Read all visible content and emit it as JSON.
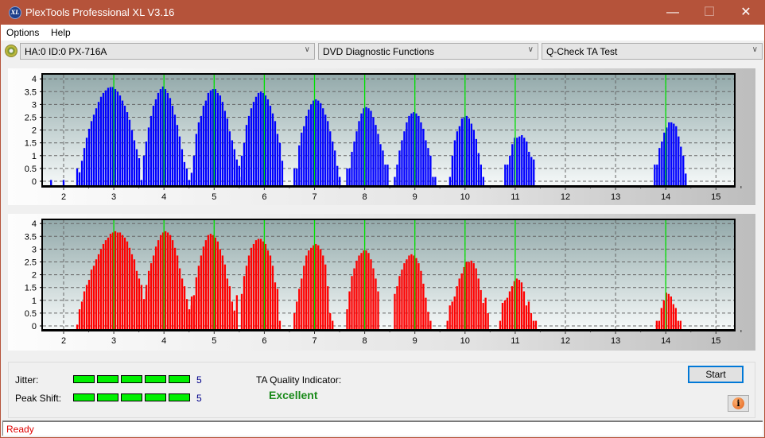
{
  "window": {
    "title": "PlexTools Professional XL V3.16",
    "app_icon_label": "XL",
    "controls": {
      "minimize": "—",
      "maximize": "☐",
      "close": "✕"
    }
  },
  "menu": {
    "items": [
      {
        "label": "Options"
      },
      {
        "label": "Help"
      }
    ]
  },
  "toolbar": {
    "drive_select": "HA:0 ID:0  PX-716A",
    "function_select": "DVD Diagnostic Functions",
    "test_select": "Q-Check TA Test",
    "arrow": "∨"
  },
  "results": {
    "jitter_label": "Jitter:",
    "jitter_score": "5",
    "jitter_fill_fraction": 1.0,
    "peak_shift_label": "Peak Shift:",
    "peak_shift_score": "5",
    "peak_shift_fill_fraction": 1.0,
    "ta_quality_label": "TA Quality Indicator:",
    "ta_quality_value": "Excellent",
    "start_label": "Start",
    "info_glyph": "i"
  },
  "status": {
    "text": "Ready"
  },
  "colors": {
    "top_bars": "#0000ff",
    "bottom_bars": "#ff0000",
    "marker_lines": "#00e000",
    "quality_text": "#1a8a1a",
    "status_text": "#e00000"
  },
  "chart_data": [
    {
      "type": "bar",
      "title": "",
      "name": "top-chart",
      "xlabel": "",
      "ylabel": "",
      "xlim": [
        1.6,
        15.5
      ],
      "ylim": [
        -0.15,
        4.15
      ],
      "xticks": [
        "2",
        "3",
        "4",
        "5",
        "6",
        "7",
        "8",
        "9",
        "10",
        "11",
        "12",
        "13",
        "14",
        "15"
      ],
      "yticks": [
        "0",
        "0.5",
        "1",
        "1.5",
        "2",
        "2.5",
        "3",
        "3.5",
        "4"
      ],
      "grid": true,
      "markers_x": [
        3,
        4,
        5,
        6,
        7,
        8,
        9,
        10,
        11,
        14
      ],
      "clusters": [
        {
          "center": 3.0,
          "start": 2.27,
          "values": [
            0.5,
            0.35,
            0.8,
            1.3,
            1.7,
            2.05,
            2.35,
            2.6,
            2.85,
            3.1,
            3.3,
            3.45,
            3.55,
            3.65,
            3.68,
            3.68,
            3.6,
            3.5,
            3.35,
            3.15,
            2.95,
            2.7,
            2.4,
            2.0,
            1.6,
            1.25,
            0.9,
            0.05
          ]
        },
        {
          "center": 4.0,
          "start": 3.6,
          "values": [
            1.0,
            1.55,
            2.1,
            2.55,
            2.95,
            3.2,
            3.45,
            3.6,
            3.7,
            3.6,
            3.45,
            3.25,
            2.95,
            2.6,
            2.2,
            1.75,
            1.25,
            0.75,
            0.5,
            0.05
          ]
        },
        {
          "center": 5.0,
          "start": 4.55,
          "values": [
            0.33,
            1.0,
            1.85,
            2.3,
            2.55,
            2.95,
            3.15,
            3.45,
            3.55,
            3.6,
            3.6,
            3.45,
            3.35,
            3.1,
            2.75,
            2.45,
            1.95,
            1.6,
            1.25,
            0.85,
            0.6,
            0.17
          ]
        },
        {
          "center": 6.0,
          "start": 5.55,
          "values": [
            1.0,
            1.5,
            2.2,
            2.55,
            2.85,
            3.1,
            3.3,
            3.45,
            3.5,
            3.45,
            3.35,
            3.2,
            2.95,
            2.65,
            2.35,
            1.85,
            1.5,
            0.8
          ]
        },
        {
          "center": 7.0,
          "start": 6.6,
          "values": [
            0.5,
            0.5,
            1.4,
            1.9,
            2.15,
            2.55,
            2.8,
            3.0,
            3.15,
            3.2,
            3.15,
            3.05,
            2.85,
            2.6,
            2.35,
            1.95,
            1.55,
            1.2,
            0.6,
            0.17
          ]
        },
        {
          "center": 8.0,
          "start": 7.65,
          "values": [
            0.5,
            0.5,
            1.15,
            1.55,
            1.95,
            2.35,
            2.65,
            2.85,
            2.9,
            2.85,
            2.75,
            2.5,
            2.2,
            1.85,
            1.45,
            1.2,
            0.65,
            0.65
          ]
        },
        {
          "center": 9.0,
          "start": 8.6,
          "values": [
            0.17,
            0.65,
            1.2,
            1.6,
            1.95,
            2.3,
            2.55,
            2.65,
            2.7,
            2.65,
            2.55,
            2.3,
            2.05,
            1.6,
            1.3,
            1.0,
            0.17,
            0.17
          ]
        },
        {
          "center": 10.0,
          "start": 9.7,
          "values": [
            0.17,
            1.0,
            1.6,
            1.95,
            2.15,
            2.45,
            2.5,
            2.55,
            2.45,
            2.25,
            2.0,
            1.65,
            1.1,
            0.65,
            0.17
          ]
        },
        {
          "center": 11.0,
          "start": 10.8,
          "values": [
            0.65,
            0.65,
            1.0,
            1.45,
            1.7,
            1.7,
            1.75,
            1.8,
            1.7,
            1.55,
            1.15,
            0.95,
            0.85
          ]
        },
        {
          "center": 14.0,
          "start": 13.78,
          "values": [
            0.65,
            0.65,
            1.3,
            1.55,
            1.9,
            2.1,
            2.3,
            2.3,
            2.25,
            2.15,
            1.75,
            1.35,
            1.0,
            0.3
          ]
        }
      ],
      "stray_bars": [
        {
          "x": 1.75,
          "value": 0.05
        },
        {
          "x": 2.0,
          "value": 0.05
        }
      ]
    },
    {
      "type": "bar",
      "title": "",
      "name": "bottom-chart",
      "xlabel": "",
      "ylabel": "",
      "xlim": [
        1.6,
        15.5
      ],
      "ylim": [
        -0.15,
        4.15
      ],
      "xticks": [
        "2",
        "3",
        "4",
        "5",
        "6",
        "7",
        "8",
        "9",
        "10",
        "11",
        "12",
        "13",
        "14",
        "15"
      ],
      "yticks": [
        "0",
        "0.5",
        "1",
        "1.5",
        "2",
        "2.5",
        "3",
        "3.5",
        "4"
      ],
      "grid": true,
      "markers_x": [
        3,
        4,
        5,
        6,
        7,
        8,
        9,
        10,
        11,
        14
      ],
      "clusters": [
        {
          "center": 3.0,
          "start": 2.27,
          "values": [
            0.0,
            0.65,
            0.95,
            1.35,
            1.6,
            1.8,
            2.2,
            2.35,
            2.6,
            2.8,
            3.0,
            3.2,
            3.35,
            3.45,
            3.6,
            3.65,
            3.7,
            3.65,
            3.65,
            3.55,
            3.45,
            3.3,
            3.05,
            2.8,
            2.6,
            2.15,
            1.85,
            1.6,
            1.05,
            1.35
          ]
        },
        {
          "center": 4.0,
          "start": 3.65,
          "values": [
            1.6,
            2.15,
            2.45,
            2.75,
            3.1,
            3.35,
            3.55,
            3.65,
            3.7,
            3.65,
            3.55,
            3.35,
            3.05,
            2.75,
            2.25,
            1.85,
            1.55,
            1.05,
            0.65,
            1.15
          ]
        },
        {
          "center": 5.0,
          "start": 4.55,
          "values": [
            0.8,
            1.2,
            1.9,
            2.35,
            2.75,
            3.1,
            3.35,
            3.55,
            3.6,
            3.55,
            3.45,
            3.3,
            3.0,
            2.75,
            2.4,
            1.85,
            1.55,
            0.95,
            0.6,
            1.2
          ]
        },
        {
          "center": 6.0,
          "start": 5.55,
          "values": [
            1.25,
            1.95,
            2.35,
            2.75,
            3.05,
            3.2,
            3.35,
            3.4,
            3.4,
            3.3,
            3.2,
            2.95,
            2.75,
            2.35,
            1.7,
            1.45,
            0.2
          ]
        },
        {
          "center": 7.0,
          "start": 6.6,
          "values": [
            0.5,
            0.95,
            1.45,
            1.85,
            2.35,
            2.75,
            2.95,
            3.05,
            3.15,
            3.2,
            3.15,
            3.0,
            2.75,
            2.4,
            1.55,
            0.5,
            0.2
          ]
        },
        {
          "center": 8.0,
          "start": 7.65,
          "values": [
            0.65,
            1.35,
            1.95,
            2.25,
            2.55,
            2.75,
            2.85,
            2.95,
            2.95,
            2.85,
            2.6,
            2.25,
            1.85,
            1.35
          ]
        },
        {
          "center": 9.0,
          "start": 8.6,
          "values": [
            1.25,
            1.55,
            1.95,
            2.2,
            2.45,
            2.6,
            2.75,
            2.8,
            2.75,
            2.65,
            2.45,
            2.15,
            1.65,
            1.1,
            0.55,
            0.2
          ]
        },
        {
          "center": 10.0,
          "start": 9.65,
          "values": [
            0.2,
            0.8,
            0.95,
            1.15,
            1.55,
            1.85,
            2.05,
            2.3,
            2.5,
            2.5,
            2.55,
            2.45,
            2.25,
            1.85,
            1.4,
            0.9,
            1.1,
            0.5
          ]
        },
        {
          "center": 11.0,
          "start": 10.7,
          "values": [
            0.2,
            0.9,
            1.0,
            1.1,
            1.35,
            1.55,
            1.75,
            1.85,
            1.8,
            1.7,
            1.35,
            0.8,
            0.95,
            0.5,
            0.2,
            0.2
          ]
        },
        {
          "center": 14.0,
          "start": 13.82,
          "values": [
            0.2,
            0.2,
            0.7,
            1.0,
            1.3,
            1.25,
            1.15,
            0.85,
            0.7,
            0.2,
            0.2
          ]
        }
      ],
      "stray_bars": []
    }
  ]
}
